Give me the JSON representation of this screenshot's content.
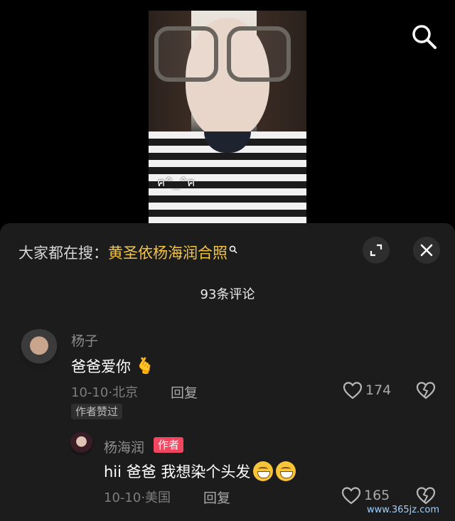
{
  "video": {
    "sticker_text": "ฅ^_^ฅ"
  },
  "hot_search": {
    "prefix": "大家都在搜：",
    "query": "黄圣依杨海润合照"
  },
  "comments_header": {
    "count_label": "93条评论"
  },
  "comments": [
    {
      "username": "杨子",
      "text": "爸爸爱你",
      "emoji": "heart-hand",
      "date": "10-10",
      "location": "北京",
      "reply_label": "回复",
      "likes": "174",
      "badge": "作者赞过"
    },
    {
      "username": "杨海润",
      "author_tag": "作者",
      "text": "hii 爸爸  我想染个头发",
      "emoji": "grinning-face",
      "date": "10-10",
      "location": "美国",
      "reply_label": "回复",
      "likes": "165"
    }
  ],
  "watermark": "www.365jz.com",
  "colors": {
    "accent": "#f3c542",
    "author_tag": "#f0465f",
    "panel": "#1c1c1c"
  }
}
